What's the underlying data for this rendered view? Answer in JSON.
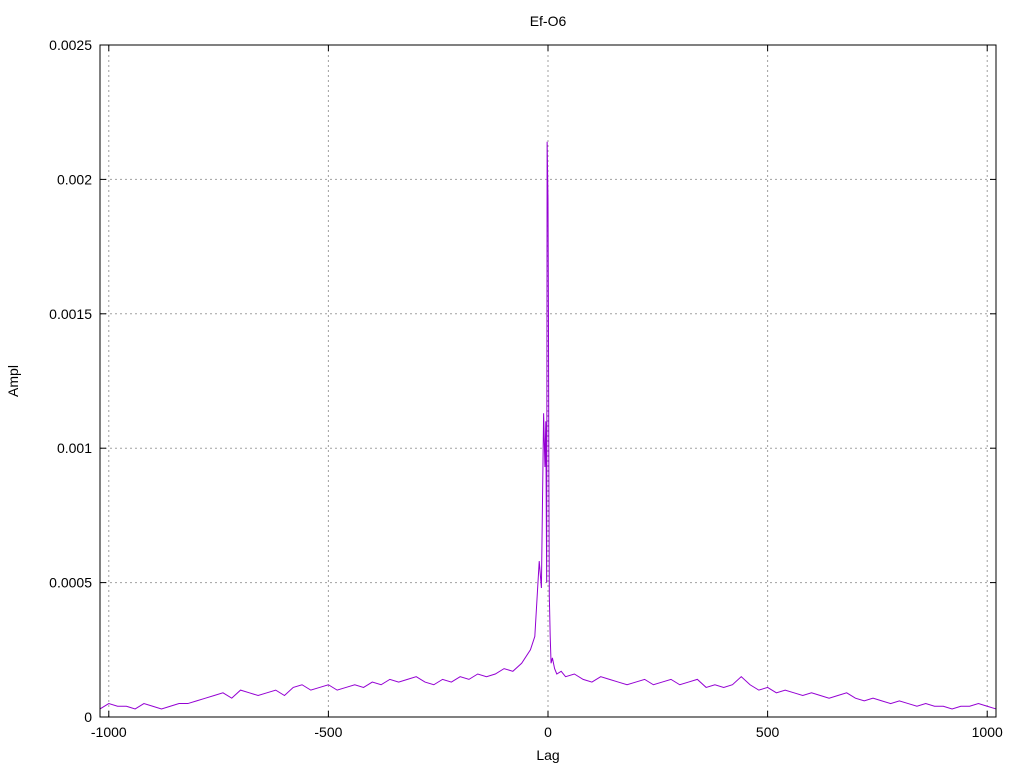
{
  "chart_data": {
    "type": "line",
    "title": "Ef-O6",
    "xlabel": "Lag",
    "ylabel": "Ampl",
    "xlim": [
      -1020,
      1020
    ],
    "ylim": [
      0,
      0.0025
    ],
    "grid": true,
    "x_ticks": [
      -1000,
      -500,
      0,
      500,
      1000
    ],
    "x_tick_labels": [
      "-1000",
      "-500",
      "0",
      "500",
      "1000"
    ],
    "y_ticks": [
      0,
      0.0005,
      0.001,
      0.0015,
      0.002,
      0.0025
    ],
    "y_tick_labels": [
      "0",
      "0.0005",
      "0.001",
      "0.0015",
      "0.002",
      "0.0025"
    ],
    "series": [
      {
        "color": "#9400d3",
        "x": [
          -1020,
          -1000,
          -980,
          -960,
          -940,
          -920,
          -900,
          -880,
          -860,
          -840,
          -820,
          -800,
          -780,
          -760,
          -740,
          -720,
          -700,
          -680,
          -660,
          -640,
          -620,
          -600,
          -580,
          -560,
          -540,
          -520,
          -500,
          -480,
          -460,
          -440,
          -420,
          -400,
          -380,
          -360,
          -340,
          -320,
          -300,
          -280,
          -260,
          -240,
          -220,
          -200,
          -180,
          -160,
          -140,
          -120,
          -100,
          -80,
          -60,
          -40,
          -30,
          -20,
          -15,
          -10,
          -7,
          -5,
          -3,
          -2,
          0,
          1,
          2,
          3,
          5,
          7,
          10,
          15,
          20,
          30,
          40,
          60,
          80,
          100,
          120,
          140,
          160,
          180,
          200,
          220,
          240,
          260,
          280,
          300,
          320,
          340,
          360,
          380,
          400,
          420,
          440,
          460,
          480,
          500,
          520,
          540,
          560,
          580,
          600,
          620,
          640,
          660,
          680,
          700,
          720,
          740,
          760,
          780,
          800,
          820,
          840,
          860,
          880,
          900,
          920,
          940,
          960,
          980,
          1000,
          1020
        ],
        "y": [
          3e-05,
          5e-05,
          4e-05,
          4e-05,
          3e-05,
          5e-05,
          4e-05,
          3e-05,
          4e-05,
          5e-05,
          5e-05,
          6e-05,
          7e-05,
          8e-05,
          9e-05,
          7e-05,
          0.0001,
          9e-05,
          8e-05,
          9e-05,
          0.0001,
          8e-05,
          0.00011,
          0.00012,
          0.0001,
          0.00011,
          0.00012,
          0.0001,
          0.00011,
          0.00012,
          0.00011,
          0.00013,
          0.00012,
          0.00014,
          0.00013,
          0.00014,
          0.00015,
          0.00013,
          0.00012,
          0.00014,
          0.00013,
          0.00015,
          0.00014,
          0.00016,
          0.00015,
          0.00016,
          0.00018,
          0.00017,
          0.0002,
          0.00025,
          0.0003,
          0.00058,
          0.00048,
          0.00113,
          0.00093,
          0.0011,
          0.0005,
          0.00214,
          0.00193,
          0.0015,
          0.0009,
          0.00045,
          0.0003,
          0.0002,
          0.00022,
          0.00018,
          0.00016,
          0.00017,
          0.00015,
          0.00016,
          0.00014,
          0.00013,
          0.00015,
          0.00014,
          0.00013,
          0.00012,
          0.00013,
          0.00014,
          0.00012,
          0.00013,
          0.00014,
          0.00012,
          0.00013,
          0.00014,
          0.00011,
          0.00012,
          0.00011,
          0.00012,
          0.00015,
          0.00012,
          0.0001,
          0.00011,
          9e-05,
          0.0001,
          9e-05,
          8e-05,
          9e-05,
          8e-05,
          7e-05,
          8e-05,
          9e-05,
          7e-05,
          6e-05,
          7e-05,
          6e-05,
          5e-05,
          6e-05,
          5e-05,
          4e-05,
          5e-05,
          4e-05,
          4e-05,
          3e-05,
          4e-05,
          4e-05,
          5e-05,
          4e-05,
          3e-05
        ]
      }
    ]
  }
}
